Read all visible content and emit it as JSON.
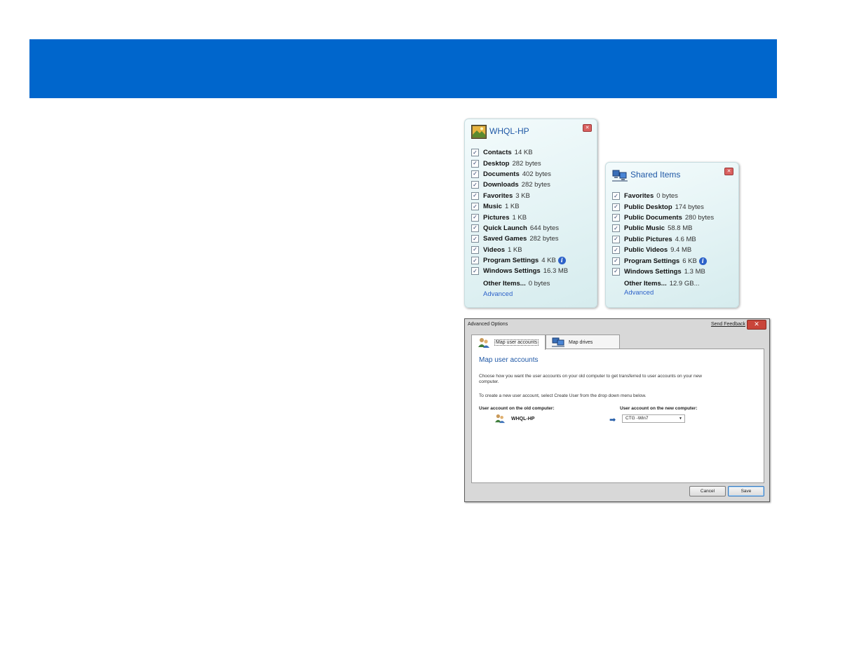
{
  "colors": {
    "banner": "#0066cc",
    "accent": "#1f58a6",
    "link": "#2d62c9"
  },
  "panel_user": {
    "title": "WHQL-HP",
    "icon": "user-picture-icon",
    "items": [
      {
        "name": "Contacts",
        "size": "14 KB",
        "checked": true
      },
      {
        "name": "Desktop",
        "size": "282 bytes",
        "checked": true
      },
      {
        "name": "Documents",
        "size": "402 bytes",
        "checked": true
      },
      {
        "name": "Downloads",
        "size": "282 bytes",
        "checked": true
      },
      {
        "name": "Favorites",
        "size": "3 KB",
        "checked": true
      },
      {
        "name": "Music",
        "size": "1 KB",
        "checked": true
      },
      {
        "name": "Pictures",
        "size": "1 KB",
        "checked": true
      },
      {
        "name": "Quick Launch",
        "size": "644 bytes",
        "checked": true
      },
      {
        "name": "Saved Games",
        "size": "282 bytes",
        "checked": true
      },
      {
        "name": "Videos",
        "size": "1 KB",
        "checked": true
      },
      {
        "name": "Program Settings",
        "size": "4 KB",
        "checked": true,
        "info": true
      },
      {
        "name": "Windows Settings",
        "size": "16.3 MB",
        "checked": true
      }
    ],
    "other_name": "Other Items...",
    "other_size": "0 bytes",
    "advanced": "Advanced"
  },
  "panel_shared": {
    "title": "Shared Items",
    "icon": "shared-computers-icon",
    "items": [
      {
        "name": "Favorites",
        "size": "0 bytes",
        "checked": true
      },
      {
        "name": "Public Desktop",
        "size": "174 bytes",
        "checked": true
      },
      {
        "name": "Public Documents",
        "size": "280 bytes",
        "checked": true
      },
      {
        "name": "Public Music",
        "size": "58.8 MB",
        "checked": true
      },
      {
        "name": "Public Pictures",
        "size": "4.6 MB",
        "checked": true
      },
      {
        "name": "Public Videos",
        "size": "9.4 MB",
        "checked": true
      },
      {
        "name": "Program Settings",
        "size": "6 KB",
        "checked": true,
        "info": true
      },
      {
        "name": "Windows Settings",
        "size": "1.3 MB",
        "checked": true
      }
    ],
    "other_name": "Other Items...",
    "other_size": "12.9 GB...",
    "advanced": "Advanced"
  },
  "window": {
    "title": "Advanced Options",
    "feedback": "Send Feedback",
    "tabs": [
      {
        "label": "Map user accounts",
        "icon": "user-accounts-icon"
      },
      {
        "label": "Map drives",
        "icon": "drives-icon"
      }
    ],
    "heading": "Map user accounts",
    "para1_line1": "Choose how you want the user accounts on your old computer to get transferred to user accounts on your new",
    "para1_line2": "computer.",
    "para2": "To create a new user account, select Create User from the drop down menu below.",
    "old_label": "User account on the old computer:",
    "new_label": "User account on the new computer:",
    "old_user": "WHQL-HP",
    "new_user": "CTG -Win7",
    "cancel": "Cancel",
    "save": "Save"
  }
}
